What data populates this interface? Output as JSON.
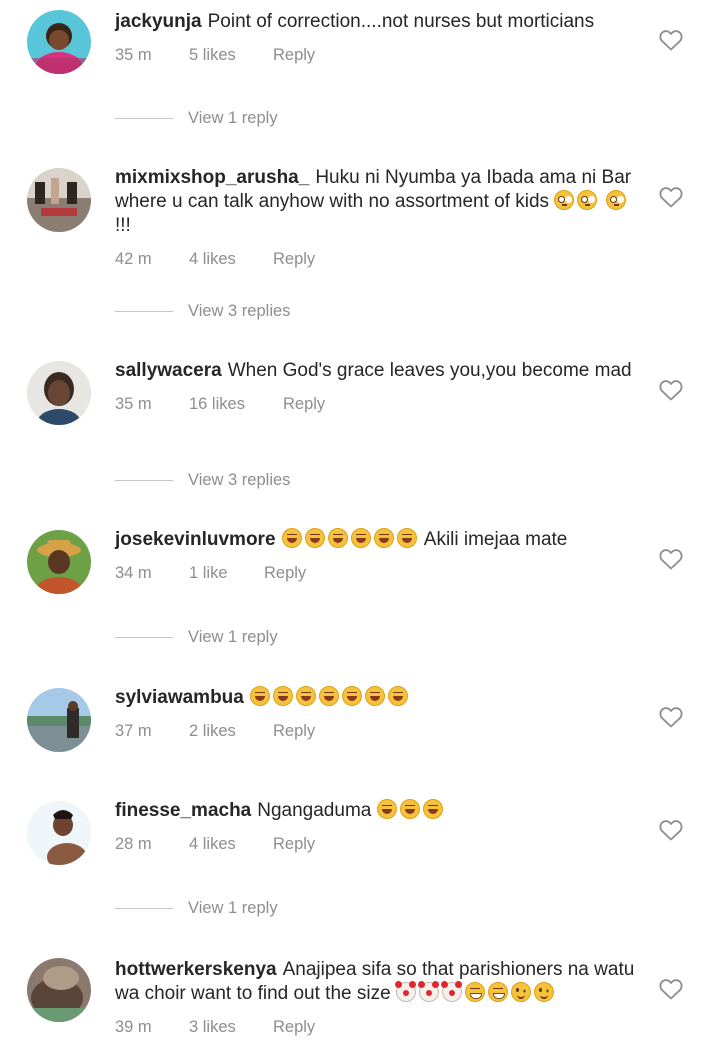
{
  "comments": [
    {
      "username": "jackyunja",
      "text": "Point of correction....not nurses but morticians",
      "time": "35 m",
      "likes": "5 likes",
      "reply": "Reply",
      "view_replies": "View 1 reply",
      "emojis": [],
      "emoji_suffix": ""
    },
    {
      "username": "mixmixshop_arusha_",
      "text": "Huku ni Nyumba ya Ibada ama ni Bar where u can talk anyhow with no assortment of kids",
      "time": "42 m",
      "likes": "4 likes",
      "reply": "Reply",
      "view_replies": "View 3 replies",
      "emojis": [
        "flushed-face",
        "flushed-face",
        "flushed-face"
      ],
      "emoji_suffix": "!!!"
    },
    {
      "username": "sallywacera",
      "text": "When God's grace leaves you,you become mad",
      "time": "35 m",
      "likes": "16 likes",
      "reply": "Reply",
      "view_replies": "View 3 replies",
      "emojis": [],
      "emoji_suffix": ""
    },
    {
      "username": "josekevinluvmore",
      "text_before": "",
      "text": "Akili imejaa mate",
      "time": "34 m",
      "likes": "1 like",
      "reply": "Reply",
      "view_replies": "View 1 reply",
      "emojis": [
        "laughing-face",
        "laughing-face",
        "laughing-face",
        "laughing-face",
        "laughing-face",
        "laughing-face"
      ],
      "emoji_suffix": ""
    },
    {
      "username": "sylviawambua",
      "text": "",
      "time": "37 m",
      "likes": "2 likes",
      "reply": "Reply",
      "view_replies": "",
      "emojis": [
        "laughing-face",
        "laughing-face",
        "laughing-face",
        "laughing-face",
        "laughing-face",
        "laughing-face",
        "laughing-face"
      ],
      "emoji_suffix": ""
    },
    {
      "username": "finesse_macha",
      "text": "Ngangaduma",
      "time": "28 m",
      "likes": "4 likes",
      "reply": "Reply",
      "view_replies": "View 1 reply",
      "emojis": [
        "laughing-face",
        "laughing-face",
        "laughing-face"
      ],
      "emoji_suffix": ""
    },
    {
      "username": "hottwerkerskenya",
      "text": "Anajipea sifa so that parishioners na watu wa choir want to find out the size",
      "time": "39 m",
      "likes": "3 likes",
      "reply": "Reply",
      "view_replies": "",
      "emojis": [
        "clown-face",
        "clown-face",
        "clown-face",
        "grinning-face",
        "grinning-face",
        "winking-face",
        "winking-face"
      ],
      "emoji_suffix": ""
    }
  ],
  "icons": {
    "like": "heart-outline-icon"
  },
  "colors": {
    "text": "#262626",
    "meta": "#8e8e8e",
    "divider": "#c7c7c7"
  }
}
